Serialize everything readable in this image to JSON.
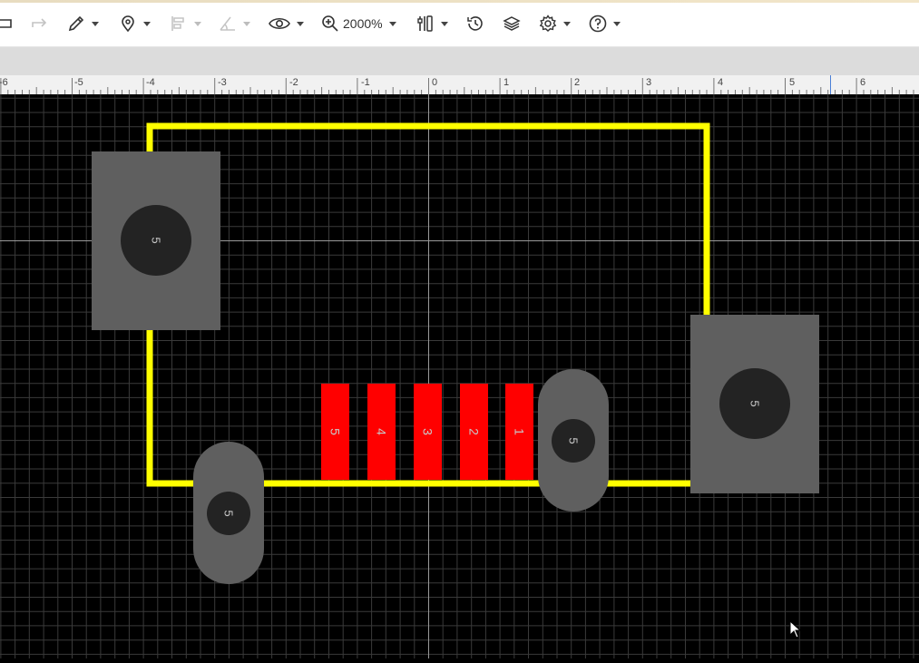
{
  "toolbar": {
    "zoom_label": "2000%",
    "tools": [
      {
        "name": "undo-button",
        "icon": "undo-icon"
      },
      {
        "name": "redo-button",
        "icon": "redo-icon"
      },
      {
        "name": "draw-tool-button",
        "icon": "pencil-icon"
      },
      {
        "name": "place-tool-button",
        "icon": "location-pin-icon"
      },
      {
        "name": "align-tool-button",
        "icon": "align-icon"
      },
      {
        "name": "measure-tool-button",
        "icon": "angle-icon"
      },
      {
        "name": "view-button",
        "icon": "eye-icon"
      },
      {
        "name": "zoom-button",
        "icon": "zoom-in-icon"
      },
      {
        "name": "tools-button",
        "icon": "toolkit-icon"
      },
      {
        "name": "history-button",
        "icon": "history-icon"
      },
      {
        "name": "layers-button",
        "icon": "layers-icon"
      },
      {
        "name": "settings-button",
        "icon": "gear-icon"
      },
      {
        "name": "help-button",
        "icon": "help-icon"
      }
    ]
  },
  "ruler": {
    "labels": [
      "-6",
      "-5",
      "-4",
      "-3",
      "-2",
      "-1",
      "0",
      "1",
      "2",
      "3",
      "4",
      "5",
      "6"
    ]
  },
  "canvas": {
    "colors": {
      "background": "#000000",
      "grid": "#3a3a3a",
      "axis": "#9a9a9a",
      "outline": "#ffff00",
      "smd_pad": "#ff0000",
      "through_pad": "#5f5f5f",
      "drill": "#232323",
      "pad_text": "#c8c8c8"
    },
    "smd_pads": [
      "5",
      "4",
      "3",
      "2",
      "1"
    ],
    "mounting_pads": [
      "5",
      "5"
    ],
    "oval_pads": [
      "5",
      "5"
    ]
  }
}
